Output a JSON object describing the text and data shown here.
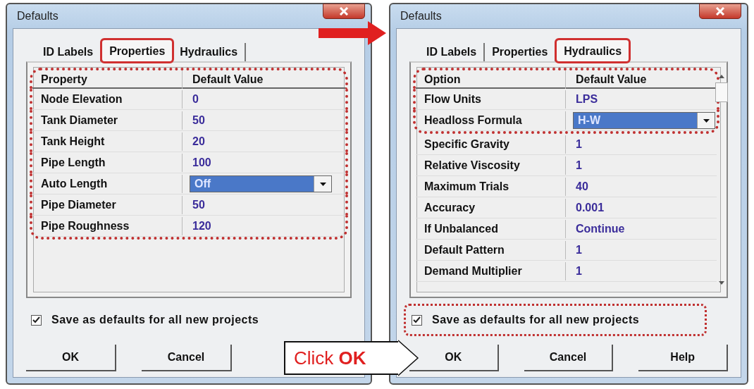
{
  "dialogs": [
    {
      "title": "Defaults",
      "tabs": [
        {
          "label": "ID Labels",
          "selected": false,
          "circled": false
        },
        {
          "label": "Properties",
          "selected": true,
          "circled": true
        },
        {
          "label": "Hydraulics",
          "selected": false,
          "circled": false
        }
      ],
      "columns": [
        "Property",
        "Default Value"
      ],
      "header_circled": true,
      "scrollbar": false,
      "rows": [
        {
          "name": "Node Elevation",
          "value": "0",
          "kind": "text",
          "circled": true
        },
        {
          "name": "Tank Diameter",
          "value": "50",
          "kind": "text",
          "circled": true
        },
        {
          "name": "Tank Height",
          "value": "20",
          "kind": "text",
          "circled": true
        },
        {
          "name": "Pipe Length",
          "value": "100",
          "kind": "text",
          "circled": true
        },
        {
          "name": "Auto Length",
          "value": "Off",
          "kind": "dropdown",
          "circled": true
        },
        {
          "name": "Pipe Diameter",
          "value": "50",
          "kind": "text",
          "circled": true
        },
        {
          "name": "Pipe Roughness",
          "value": "120",
          "kind": "text",
          "circled": true
        }
      ],
      "checkbox": {
        "label": "Save as defaults for all new projects",
        "checked": true,
        "circled": false
      },
      "buttons": [
        "OK",
        "Cancel"
      ]
    },
    {
      "title": "Defaults",
      "tabs": [
        {
          "label": "ID Labels",
          "selected": false,
          "circled": false
        },
        {
          "label": "Properties",
          "selected": false,
          "circled": false
        },
        {
          "label": "Hydraulics",
          "selected": true,
          "circled": true
        }
      ],
      "columns": [
        "Option",
        "Default Value"
      ],
      "header_circled": true,
      "scrollbar": true,
      "rows": [
        {
          "name": "Flow Units",
          "value": "LPS",
          "kind": "text",
          "circled": true
        },
        {
          "name": "Headloss Formula",
          "value": "H-W",
          "kind": "dropdown",
          "circled": true
        },
        {
          "name": "Specific Gravity",
          "value": "1",
          "kind": "text",
          "circled": false
        },
        {
          "name": "Relative Viscosity",
          "value": "1",
          "kind": "text",
          "circled": false
        },
        {
          "name": "Maximum Trials",
          "value": "40",
          "kind": "text",
          "circled": false
        },
        {
          "name": "Accuracy",
          "value": "0.001",
          "kind": "text",
          "circled": false
        },
        {
          "name": "If Unbalanced",
          "value": "Continue",
          "kind": "text",
          "circled": false
        },
        {
          "name": "Default Pattern",
          "value": "1",
          "kind": "text",
          "circled": false
        },
        {
          "name": "Demand Multiplier",
          "value": "1",
          "kind": "text",
          "circled": false
        }
      ],
      "checkbox": {
        "label": "Save as defaults for all new projects",
        "checked": true,
        "circled": true
      },
      "buttons": [
        "OK",
        "Cancel",
        "Help"
      ]
    }
  ],
  "callout": "Click **OK**"
}
